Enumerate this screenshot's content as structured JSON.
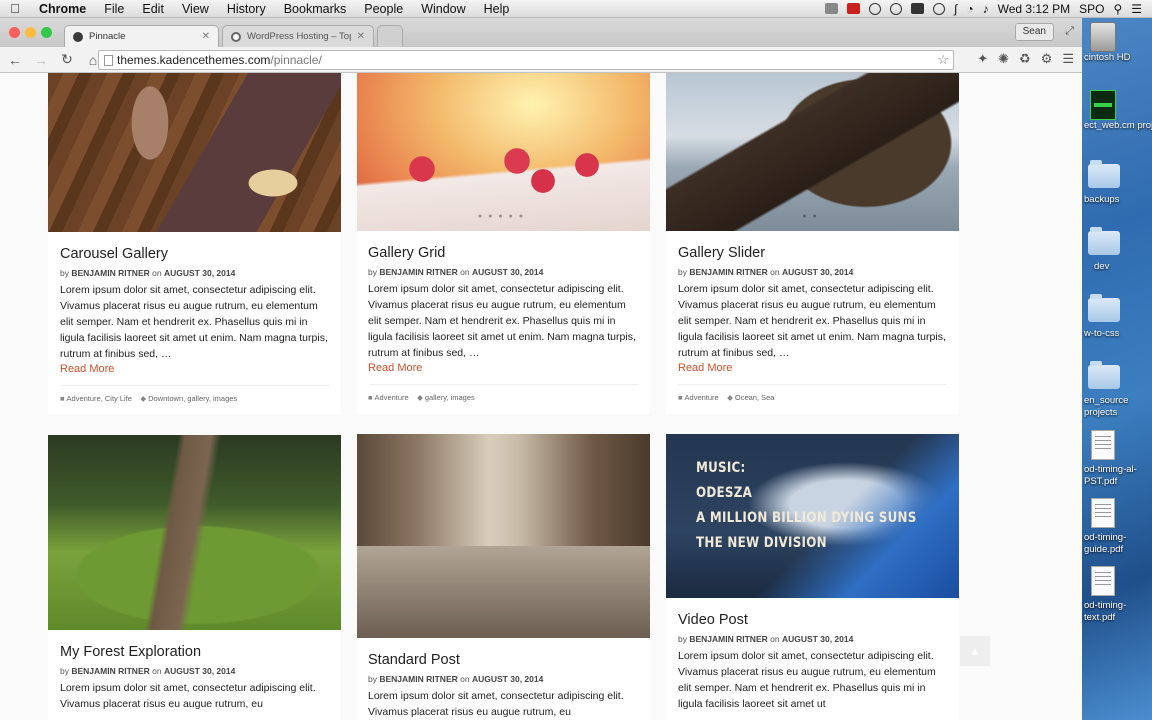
{
  "menubar": {
    "app": "Chrome",
    "items": [
      "File",
      "Edit",
      "View",
      "History",
      "Bookmarks",
      "People",
      "Window",
      "Help"
    ],
    "clock": "Wed 3:12 PM",
    "user": "SPO"
  },
  "browser": {
    "tabs": [
      {
        "title": "Pinnacle",
        "active": true
      },
      {
        "title": "WordPress Hosting – Top S",
        "active": false
      }
    ],
    "profile_button": "Sean",
    "url_host": "themes.kadencethemes.com",
    "url_path": "/pinnacle/"
  },
  "desktop": {
    "items": [
      "cintosh HD",
      "ect_web.cm proj",
      "backups",
      "dev",
      "w-to-css",
      "en_source projects",
      "od-timing-al-PST.pdf",
      "od-timing-guide.pdf",
      "od-timing-text.pdf"
    ]
  },
  "posts": [
    {
      "title": "Carousel Gallery",
      "by": "by",
      "author": "BENJAMIN RITNER",
      "on": "on",
      "date": "AUGUST 30, 2014",
      "excerpt": "Lorem ipsum dolor sit amet, consectetur adipiscing elit. Vivamus placerat risus eu augue rutrum, eu elementum elit semper. Nam et hendrerit ex. Phasellus quis mi in ligula facilisis laoreet sit amet ut enim. Nam magna turpis, rutrum at finibus sed, …",
      "read_more": "Read More",
      "categories": "Adventure, City Life",
      "tags": "Downtown, gallery, images"
    },
    {
      "title": "Gallery Grid",
      "by": "by",
      "author": "BENJAMIN RITNER",
      "on": "on",
      "date": "AUGUST 30, 2014",
      "excerpt": "Lorem ipsum dolor sit amet, consectetur adipiscing elit. Vivamus placerat risus eu augue rutrum, eu elementum elit semper. Nam et hendrerit ex. Phasellus quis mi in ligula facilisis laoreet sit amet ut enim. Nam magna turpis, rutrum at finibus sed, …",
      "read_more": "Read More",
      "categories": "Adventure",
      "tags": "gallery, images"
    },
    {
      "title": "Gallery Slider",
      "by": "by",
      "author": "BENJAMIN RITNER",
      "on": "on",
      "date": "AUGUST 30, 2014",
      "excerpt": "Lorem ipsum dolor sit amet, consectetur adipiscing elit. Vivamus placerat risus eu augue rutrum, eu elementum elit semper. Nam et hendrerit ex. Phasellus quis mi in ligula facilisis laoreet sit amet ut enim. Nam magna turpis, rutrum at finibus sed, …",
      "read_more": "Read More",
      "categories": "Adventure",
      "tags": "Ocean, Sea"
    },
    {
      "title": "My Forest Exploration",
      "by": "by",
      "author": "BENJAMIN RITNER",
      "on": "on",
      "date": "AUGUST 30, 2014",
      "excerpt": "Lorem ipsum dolor sit amet, consectetur adipiscing elit. Vivamus placerat risus eu augue rutrum, eu"
    },
    {
      "title": "Standard Post",
      "by": "by",
      "author": "BENJAMIN RITNER",
      "on": "on",
      "date": "AUGUST 30, 2014",
      "excerpt": "Lorem ipsum dolor sit amet, consectetur adipiscing elit. Vivamus placerat risus eu augue rutrum, eu"
    },
    {
      "title": "Video Post",
      "by": "by",
      "author": "BENJAMIN RITNER",
      "on": "on",
      "date": "AUGUST 30, 2014",
      "excerpt": "Lorem ipsum dolor sit amet, consectetur adipiscing elit. Vivamus placerat risus eu augue rutrum, eu elementum elit semper. Nam et hendrerit ex. Phasellus quis mi in ligula facilisis laoreet sit amet ut"
    }
  ],
  "video_thumb": {
    "line1": "MUSIC:",
    "line2": "ODESZA",
    "line3": "A MILLION BILLION DYING SUNS",
    "line4": "THE NEW DIVISION"
  },
  "icons": {
    "category": "folder-icon",
    "tag": "tag-icon",
    "scroll_top": "chevron-up-icon"
  },
  "colors": {
    "read_more": "#d2502c"
  }
}
